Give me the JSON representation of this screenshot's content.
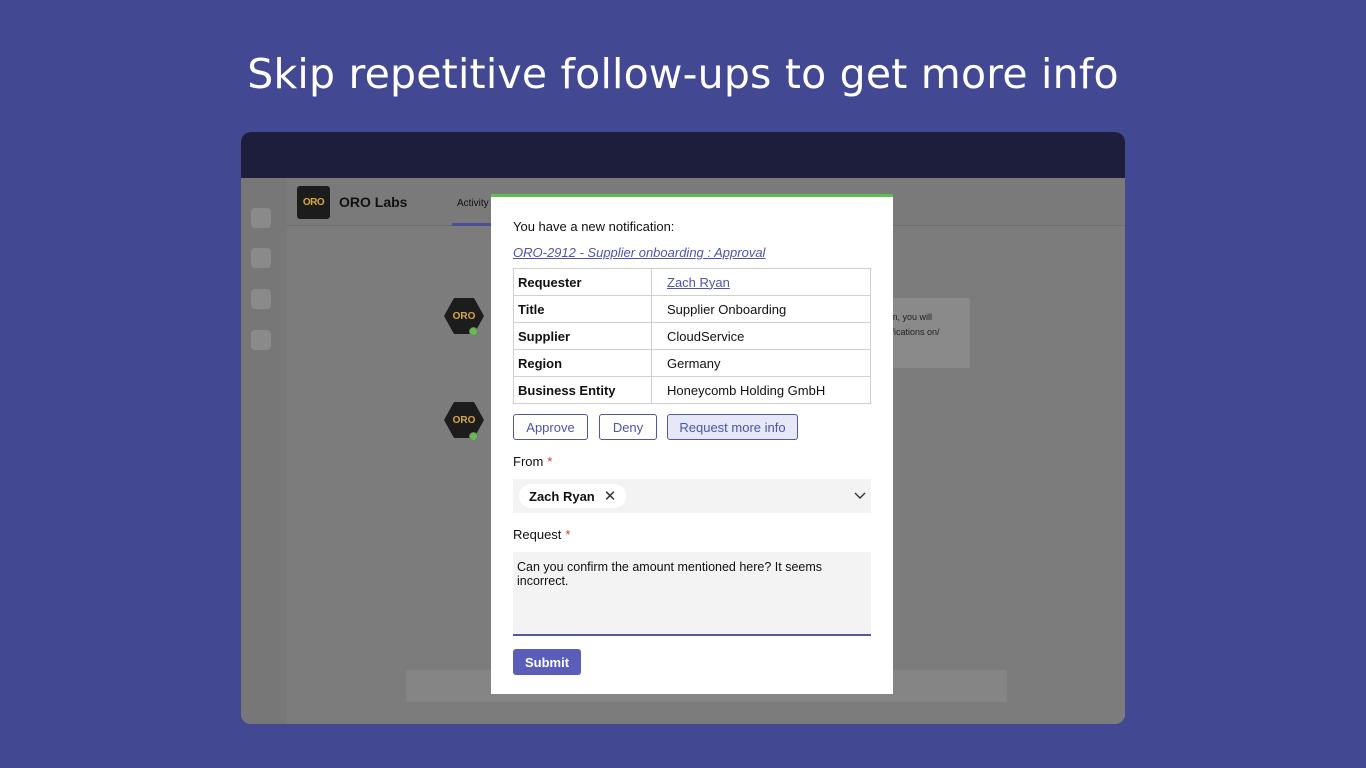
{
  "headline": "Skip repetitive follow-ups to get more info",
  "app": {
    "brand": "ORO Labs",
    "logo_text": "ORO",
    "tab_activity": "Activity",
    "background_card_text": "rm, you will tifications on/"
  },
  "notification": {
    "intro": "You have a new notification:",
    "link": "ORO-2912 - Supplier onboarding : Approval",
    "details": [
      {
        "key": "Requester",
        "value": "Zach Ryan"
      },
      {
        "key": "Title",
        "value": "Supplier Onboarding"
      },
      {
        "key": "Supplier",
        "value": "CloudService"
      },
      {
        "key": "Region",
        "value": "Germany"
      },
      {
        "key": "Business Entity",
        "value": "Honeycomb Holding GmbH"
      }
    ],
    "buttons": {
      "approve": "Approve",
      "deny": "Deny",
      "request_more_info": "Request more info"
    },
    "from_label": "From",
    "required_mark": "*",
    "from_value": "Zach Ryan",
    "request_label": "Request",
    "request_text": "Can you confirm the amount mentioned here? It seems incorrect.",
    "submit": "Submit"
  },
  "colors": {
    "background": "#434893",
    "accent": "#5a5eb8",
    "success_bar": "#58c24a",
    "titlebar": "#1d1e3c"
  }
}
